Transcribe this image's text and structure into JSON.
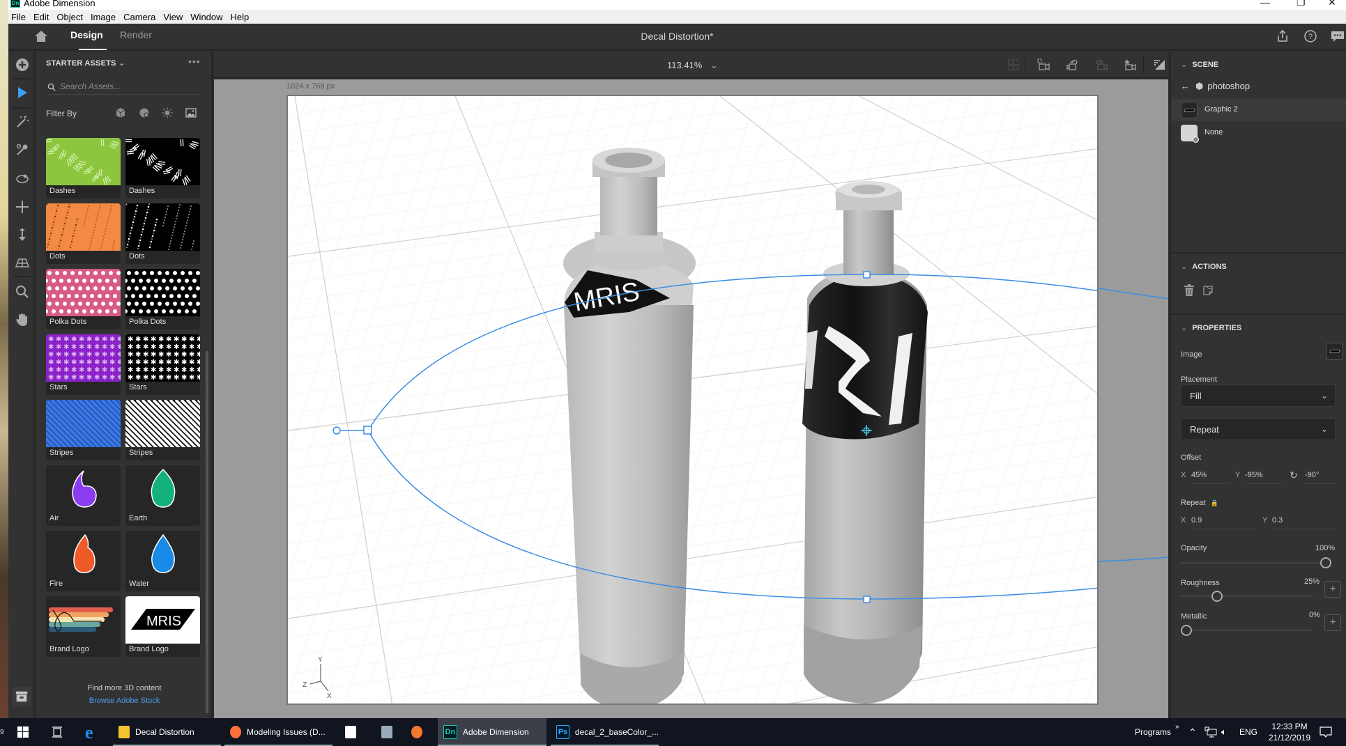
{
  "window": {
    "title": "Adobe Dimension",
    "app_icon": "Dn",
    "controls": [
      "minimize-icon",
      "restore-icon",
      "close-icon"
    ]
  },
  "menubar": [
    "File",
    "Edit",
    "Object",
    "Image",
    "Camera",
    "View",
    "Window",
    "Help"
  ],
  "header": {
    "tabs": [
      {
        "label": "Design",
        "active": true
      },
      {
        "label": "Render",
        "active": false
      }
    ],
    "document_title": "Decal Distortion*",
    "icons": [
      "share-icon",
      "help-icon",
      "feedback-icon"
    ]
  },
  "tools": [
    "add-icon",
    "select-icon",
    "magic-wand-icon",
    "eyedropper-icon",
    "orbit-icon",
    "pan-move-icon",
    "dolly-icon",
    "horizon-icon",
    "zoom-icon",
    "hand-icon",
    "library-box-icon"
  ],
  "assets": {
    "header": "STARTER ASSETS",
    "more": "•••",
    "search_placeholder": "Search Assets...",
    "filter_label": "Filter By",
    "filter_icons": [
      "models-icon",
      "materials-icon",
      "lights-icon",
      "images-icon"
    ],
    "items": [
      {
        "label": "Dashes",
        "pattern": "dashes",
        "bg": "#8cc63f",
        "fg": "#d6efa8"
      },
      {
        "label": "Dashes",
        "pattern": "dashes",
        "bg": "#000000",
        "fg": "#ffffff"
      },
      {
        "label": "Dots",
        "pattern": "dots",
        "bg": "#f28a44",
        "fg": "#8a3a10"
      },
      {
        "label": "Dots",
        "pattern": "dots",
        "bg": "#000000",
        "fg": "#ffffff"
      },
      {
        "label": "Polka Dots",
        "pattern": "polka",
        "bg": "#d85b84",
        "fg": "#ffffff"
      },
      {
        "label": "Polka Dots",
        "pattern": "polka",
        "bg": "#000000",
        "fg": "#ffffff"
      },
      {
        "label": "Stars",
        "pattern": "stars",
        "bg": "#8a22c8",
        "fg": "#d9b3f0"
      },
      {
        "label": "Stars",
        "pattern": "stars",
        "bg": "#000000",
        "fg": "#ffffff"
      },
      {
        "label": "Stripes",
        "pattern": "stripes",
        "bg": "#1e4fb8",
        "fg": "#3c78e0"
      },
      {
        "label": "Stripes",
        "pattern": "stripes",
        "bg": "#000000",
        "fg": "#ffffff"
      },
      {
        "label": "Air",
        "pattern": "air",
        "bg": "#262626",
        "fg": "#8a3cf0"
      },
      {
        "label": "Earth",
        "pattern": "earth",
        "bg": "#262626",
        "fg": "#14b27a"
      },
      {
        "label": "Fire",
        "pattern": "fire",
        "bg": "#262626",
        "fg": "#f05a28"
      },
      {
        "label": "Water",
        "pattern": "water",
        "bg": "#262626",
        "fg": "#1a8ae8"
      },
      {
        "label": "Brand Logo",
        "pattern": "brush",
        "bg": "#262626",
        "fg": "#e06a5a"
      },
      {
        "label": "Brand Logo",
        "pattern": "mris",
        "bg": "#ffffff",
        "fg": "#000000"
      }
    ],
    "find_more": "Find more 3D content",
    "browse_link": "Browse Adobe Stock"
  },
  "viewport": {
    "zoom": "113.41%",
    "doc_size": "1024 x 768 px",
    "toolbar_icons": [
      "frame-selection-icon",
      "frame-camera-icon",
      "undo-camera-icon",
      "redo-camera-icon",
      "bookmark-camera-icon",
      "render-preview-icon"
    ],
    "logo_text": "MRIS",
    "axis_labels": {
      "x": "X",
      "y": "Y",
      "z": "Z"
    }
  },
  "scene": {
    "title": "SCENE",
    "parent": "photoshop",
    "items": [
      {
        "label": "Graphic 2",
        "selected": true
      },
      {
        "label": "None",
        "selected": false
      }
    ]
  },
  "actions": {
    "title": "ACTIONS",
    "icons": [
      "delete-icon",
      "sticker-icon"
    ]
  },
  "properties": {
    "title": "PROPERTIES",
    "image_label": "Image",
    "placement_label": "Placement",
    "placement_value": "Fill",
    "wrap_value": "Repeat",
    "offset_label": "Offset",
    "offset": {
      "x_label": "X",
      "x": "45%",
      "y_label": "Y",
      "y": "-95%",
      "rotation": "-90°"
    },
    "repeat_label": "Repeat",
    "repeat": {
      "x_label": "X",
      "x": "0.9",
      "y_label": "Y",
      "y": "0.3"
    },
    "opacity": {
      "label": "Opacity",
      "value": "100%",
      "fraction": 1.0
    },
    "roughness": {
      "label": "Roughness",
      "value": "25%",
      "fraction": 0.25
    },
    "metallic": {
      "label": "Metallic",
      "value": "0%",
      "fraction": 0.0
    }
  },
  "taskbar": {
    "items": [
      {
        "label": "Decal Distortion",
        "icon": "folder-icon",
        "color": "#f4c430"
      },
      {
        "label": "Modeling Issues (D...",
        "icon": "firefox-icon",
        "color": "#ff7139"
      },
      {
        "label": "",
        "icon": "calendar-icon",
        "color": "#ffffff"
      },
      {
        "label": "",
        "icon": "monitor-app-icon",
        "color": "#9ab"
      },
      {
        "label": "",
        "icon": "blender-icon",
        "color": "#f5792a"
      },
      {
        "label": "Adobe Dimension",
        "icon": "Dn",
        "color": "#1fc8a5",
        "active": true
      },
      {
        "label": "decal_2_baseColor_...",
        "icon": "Ps",
        "color": "#31a8ff"
      }
    ],
    "programs": "Programs",
    "language": "ENG",
    "time": "12:33 PM",
    "date": "21/12/2019"
  },
  "colors": {
    "accent": "#4a9ff5",
    "selection": "#3a8ee6"
  }
}
